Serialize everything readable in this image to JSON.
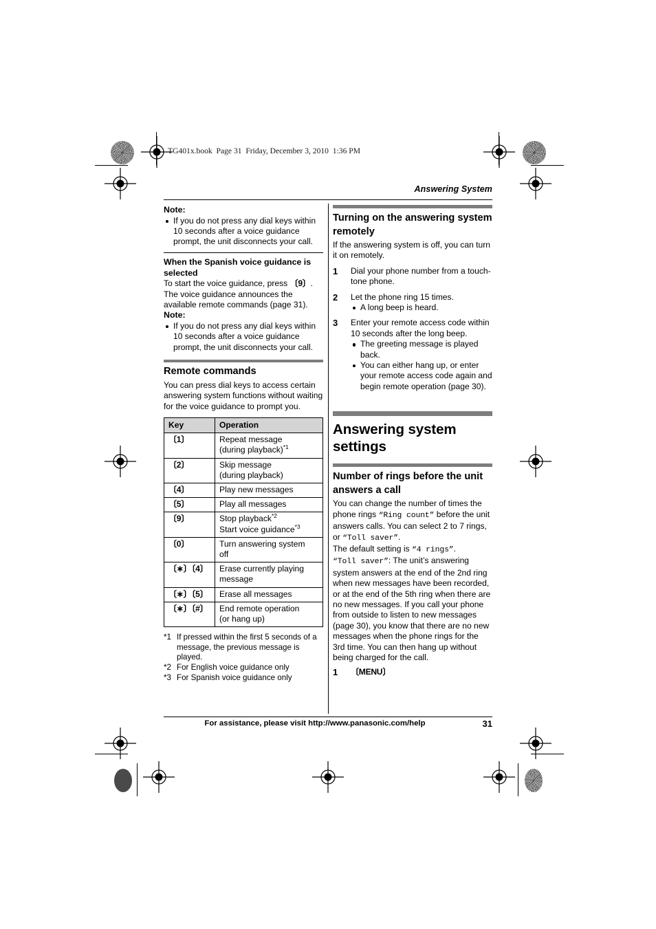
{
  "slug": "TG401x.book  Page 31  Friday, December 3, 2010  1:36 PM",
  "running_head": "Answering System",
  "left_column": {
    "note1_label": "Note:",
    "note1_bullets": [
      "If you do not press any dial keys within 10 seconds after a voice guidance prompt, the unit disconnects your call."
    ],
    "spanish_heading": "When the Spanish voice guidance is selected",
    "spanish_body_pre": "To start the voice guidance, press ",
    "spanish_body_key": "{9}",
    "spanish_body_post": ". The voice guidance announces the available remote commands (page 31).",
    "note2_label": "Note:",
    "note2_bullets": [
      "If you do not press any dial keys within 10 seconds after a voice guidance prompt, the unit disconnects your call."
    ],
    "remote_commands_heading": "Remote commands",
    "remote_commands_body": "You can press dial keys to access certain answering system functions without waiting for the voice guidance to prompt you.",
    "table": {
      "headers": [
        "Key",
        "Operation"
      ],
      "rows": [
        {
          "key": "{1}",
          "op_lines": [
            "Repeat message",
            "(during playback)"
          ],
          "sup": "*1",
          "sup_line": 1
        },
        {
          "key": "{2}",
          "op_lines": [
            "Skip message",
            "(during playback)"
          ],
          "sup": "",
          "sup_line": -1
        },
        {
          "key": "{4}",
          "op_lines": [
            "Play new messages"
          ],
          "sup": "",
          "sup_line": -1
        },
        {
          "key": "{5}",
          "op_lines": [
            "Play all messages"
          ],
          "sup": "",
          "sup_line": -1
        },
        {
          "key": "{9}",
          "op_lines": [
            "Stop playback",
            "Start voice guidance"
          ],
          "sup": "*2",
          "sup2": "*3",
          "sup_line": 0
        },
        {
          "key": "{0}",
          "op_lines": [
            "Turn answering system",
            "off"
          ],
          "sup": "",
          "sup_line": -1
        },
        {
          "key": "{∗}{4}",
          "op_lines": [
            "Erase currently playing",
            "message"
          ],
          "sup": "",
          "sup_line": -1
        },
        {
          "key": "{∗}{5}",
          "op_lines": [
            "Erase all messages"
          ],
          "sup": "",
          "sup_line": -1
        },
        {
          "key": "{∗}{#}",
          "op_lines": [
            "End remote operation",
            "(or hang up)"
          ],
          "sup": "",
          "sup_line": -1
        }
      ]
    },
    "footnotes": [
      {
        "marker": "*1",
        "text": "If pressed within the first 5 seconds of a message, the previous message is played."
      },
      {
        "marker": "*2",
        "text": "For English voice guidance only"
      },
      {
        "marker": "*3",
        "text": "For Spanish voice guidance only"
      }
    ]
  },
  "right_column": {
    "turning_on_heading": "Turning on the answering system remotely",
    "turning_on_intro": "If the answering system is off, you can turn it on remotely.",
    "steps": [
      {
        "num": "1",
        "text": "Dial your phone number from a touch-tone phone.",
        "bullets": []
      },
      {
        "num": "2",
        "text": "Let the phone ring 15 times.",
        "bullets": [
          "A long beep is heard."
        ]
      },
      {
        "num": "3",
        "text": "Enter your remote access code within 10 seconds after the long beep.",
        "bullets": [
          "The greeting message is played back.",
          "You can either hang up, or enter your remote access code again and begin remote operation (page 30)."
        ]
      }
    ],
    "section_title": "Answering system settings",
    "rings_heading": "Number of rings before the unit answers a call",
    "rings_p1_a": "You can change the number of times the phone rings ",
    "rings_p1_mono1": "“Ring count”",
    "rings_p1_b": " before the unit answers calls. You can select 2 to 7 rings, or ",
    "rings_p1_mono2": "“Toll saver”",
    "rings_p1_c": ".",
    "rings_p2_a": "The default setting is ",
    "rings_p2_mono": "“4 rings”",
    "rings_p2_b": ".",
    "rings_p3_mono": "“Toll saver”",
    "rings_p3_text": ": The unit’s answering system answers at the end of the 2nd ring when new messages have been recorded, or at the end of the 5th ring when there are no new messages. If you call your phone from outside to listen to new messages (page 30), you know that there are no new messages when the phone rings for the 3rd time. You can then hang up without being charged for the call.",
    "final_step_num": "1",
    "final_step_key": "{MENU}"
  },
  "footer": {
    "assistance": "For assistance, please visit http://www.panasonic.com/help",
    "page_number": "31"
  },
  "colors": {
    "grey_bar": "#7d7d7d",
    "table_header_bg": "#d4d4d4",
    "text": "#000000"
  }
}
